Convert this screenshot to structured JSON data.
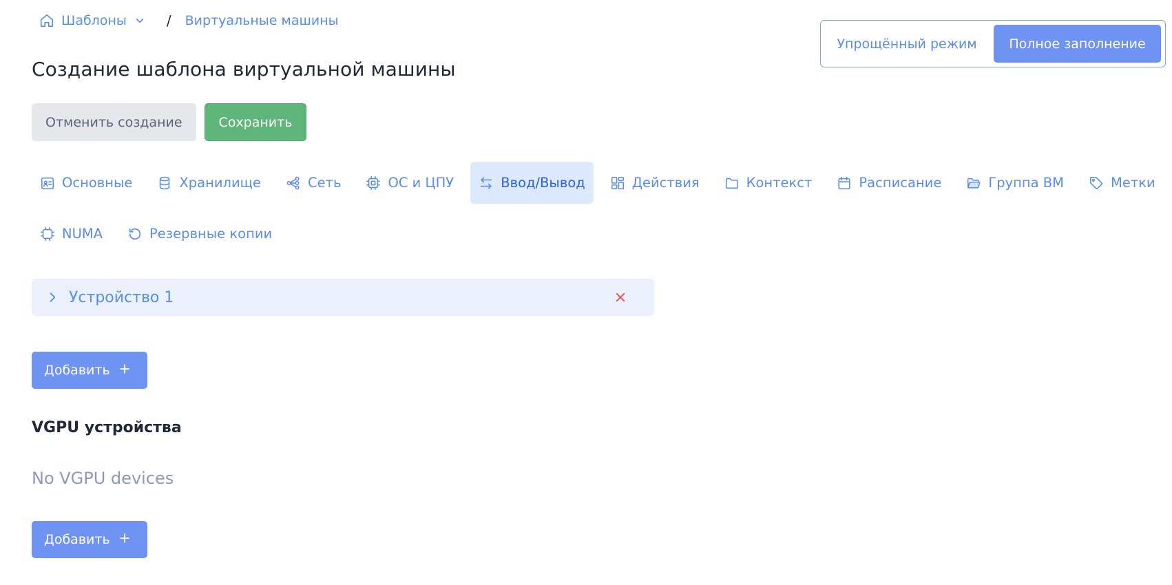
{
  "breadcrumb": {
    "root": "Шаблоны",
    "separator": "/",
    "current": "Виртуальные машины"
  },
  "page": {
    "title": "Создание шаблона виртуальной машины"
  },
  "mode_switch": {
    "simple_label": "Упрощённый режим",
    "full_label": "Полное заполнение",
    "active": "full"
  },
  "actions": {
    "cancel_label": "Отменить создание",
    "save_label": "Сохранить"
  },
  "tabs": [
    {
      "label": "Основные",
      "icon": "user-card-icon"
    },
    {
      "label": "Хранилище",
      "icon": "database-icon"
    },
    {
      "label": "Сеть",
      "icon": "network-icon"
    },
    {
      "label": "ОС и ЦПУ",
      "icon": "cpu-icon"
    },
    {
      "label": "Ввод/Вывод",
      "icon": "arrows-left-right-icon",
      "active": true
    },
    {
      "label": "Действия",
      "icon": "dashboard-icon"
    },
    {
      "label": "Контекст",
      "icon": "folder-icon"
    },
    {
      "label": "Расписание",
      "icon": "calendar-icon"
    },
    {
      "label": "Группа ВМ",
      "icon": "folder-open-icon"
    },
    {
      "label": "Метки",
      "icon": "tag-icon"
    },
    {
      "label": "NUMA",
      "icon": "chip-icon"
    },
    {
      "label": "Резервные копии",
      "icon": "history-icon"
    }
  ],
  "devices": {
    "items": [
      {
        "label": "Устройство 1"
      }
    ],
    "add_label": "Добавить"
  },
  "vgpu": {
    "title": "VGPU устройства",
    "empty_text": "No VGPU devices",
    "add_label": "Добавить"
  },
  "colors": {
    "accent": "#6e93f3",
    "link": "#5b8ce6",
    "save": "#5fb57a",
    "danger": "#ef4444",
    "active_tab_bg": "#dde9fc"
  }
}
